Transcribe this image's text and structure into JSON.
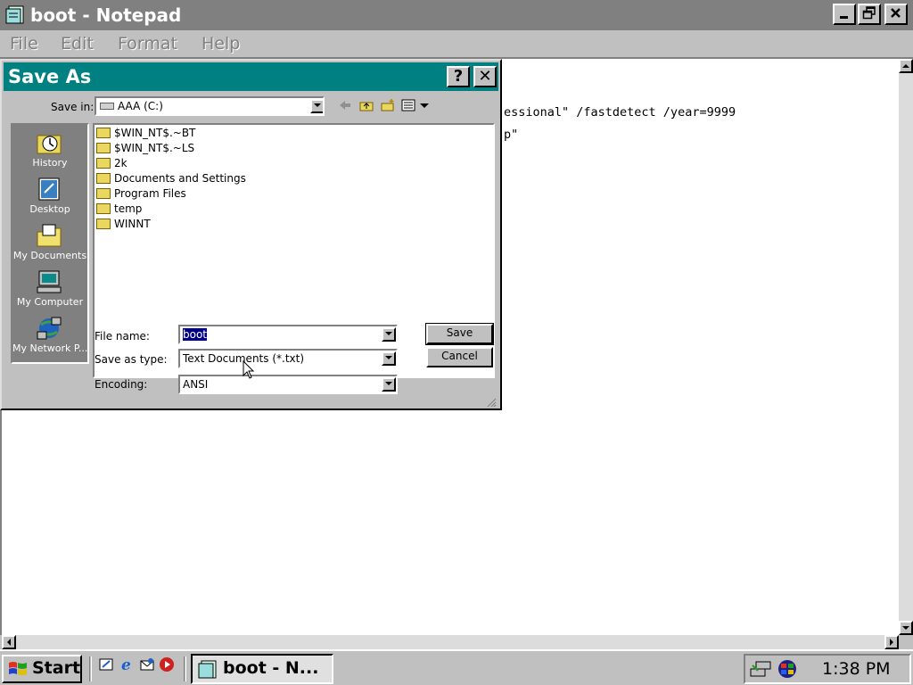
{
  "notepad": {
    "title": "boot - Notepad",
    "menu": [
      "File",
      "Edit",
      "Format",
      "Help"
    ],
    "visible_lines": [
      "essional\" /fastdetect /year=9999",
      "p\""
    ]
  },
  "dialog": {
    "title": "Save As",
    "help_glyph": "?",
    "close_glyph": "✕",
    "save_in_label": "Save in:",
    "save_in_value": "AAA (C:)",
    "places": [
      {
        "label": "History",
        "icon": "history-icon"
      },
      {
        "label": "Desktop",
        "icon": "desktop-icon"
      },
      {
        "label": "My Documents",
        "icon": "my-documents-icon"
      },
      {
        "label": "My Computer",
        "icon": "my-computer-icon"
      },
      {
        "label": "My Network P...",
        "icon": "network-icon"
      }
    ],
    "files": [
      "$WIN_NT$.~BT",
      "$WIN_NT$.~LS",
      "2k",
      "Documents and Settings",
      "Program Files",
      "temp",
      "WINNT"
    ],
    "file_name_label": "File name:",
    "file_name_value": "boot",
    "type_label": "Save as type:",
    "type_value": "Text Documents (*.txt)",
    "encoding_label": "Encoding:",
    "encoding_value": "ANSI",
    "save_button": "Save",
    "cancel_button": "Cancel"
  },
  "taskbar": {
    "start_label": "Start",
    "task_label": "boot - N...",
    "clock": "1:38 PM"
  },
  "colors": {
    "dialog_title_bar": "#008080",
    "inactive_title_bar": "#808080",
    "face": "#c0c0c0"
  }
}
